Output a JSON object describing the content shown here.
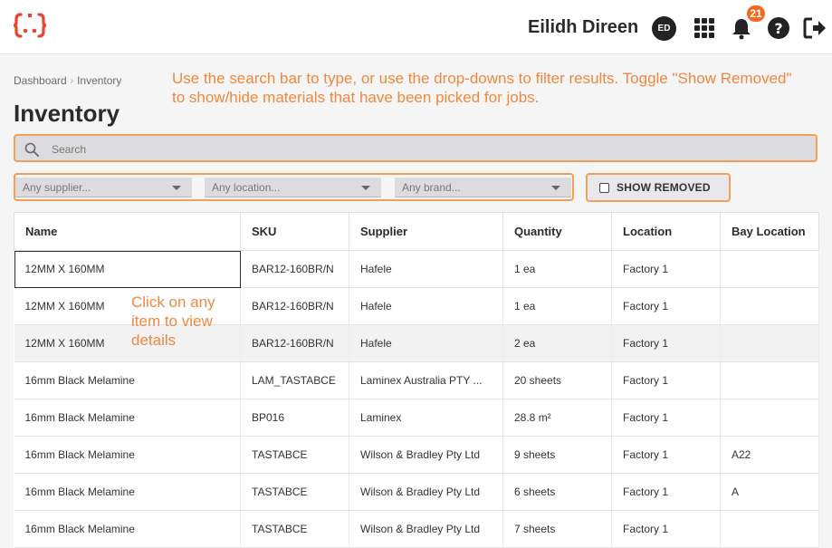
{
  "header": {
    "user_name": "Eilidh Direen",
    "avatar_initials": "ED",
    "notification_count": "21",
    "accent_color": "#f26a21",
    "icons": [
      "apps-grid-icon",
      "bell-icon",
      "help-icon",
      "logout-icon"
    ]
  },
  "breadcrumb": {
    "items": [
      "Dashboard",
      "Inventory"
    ]
  },
  "page": {
    "title": "Inventory"
  },
  "hints": {
    "top": "Use the search bar to type, or use the drop-downs to filter results. Toggle \"Show Removed\" to show/hide materials that have been picked for jobs.",
    "click": "Click on any item to view details"
  },
  "search": {
    "placeholder": "Search"
  },
  "filters": {
    "supplier": "Any supplier...",
    "location": "Any location...",
    "brand": "Any brand...",
    "show_removed_label": "SHOW REMOVED",
    "show_removed_checked": false
  },
  "table": {
    "columns": [
      "Name",
      "SKU",
      "Supplier",
      "Quantity",
      "Location",
      "Bay Location"
    ],
    "rows": [
      [
        "12MM X 160MM",
        "BAR12-160BR/N",
        "Hafele",
        "1 ea",
        "Factory 1",
        ""
      ],
      [
        "12MM X 160MM",
        "BAR12-160BR/N",
        "Hafele",
        "1 ea",
        "Factory 1",
        ""
      ],
      [
        "12MM X 160MM",
        "BAR12-160BR/N",
        "Hafele",
        "2 ea",
        "Factory 1",
        ""
      ],
      [
        "16mm Black Melamine",
        "LAM_TASTABCE",
        "Laminex Australia PTY ...",
        "20 sheets",
        "Factory 1",
        ""
      ],
      [
        "16mm Black Melamine",
        "BP016",
        "Laminex",
        "28.8 m²",
        "Factory 1",
        ""
      ],
      [
        "16mm Black Melamine",
        "TASTABCE",
        "Wilson & Bradley Pty Ltd",
        "9 sheets",
        "Factory 1",
        "A22"
      ],
      [
        "16mm Black Melamine",
        "TASTABCE",
        "Wilson & Bradley Pty Ltd",
        "6 sheets",
        "Factory 1",
        "A"
      ],
      [
        "16mm Black Melamine",
        "TASTABCE",
        "Wilson & Bradley Pty Ltd",
        "7 sheets",
        "Factory 1",
        ""
      ]
    ]
  }
}
